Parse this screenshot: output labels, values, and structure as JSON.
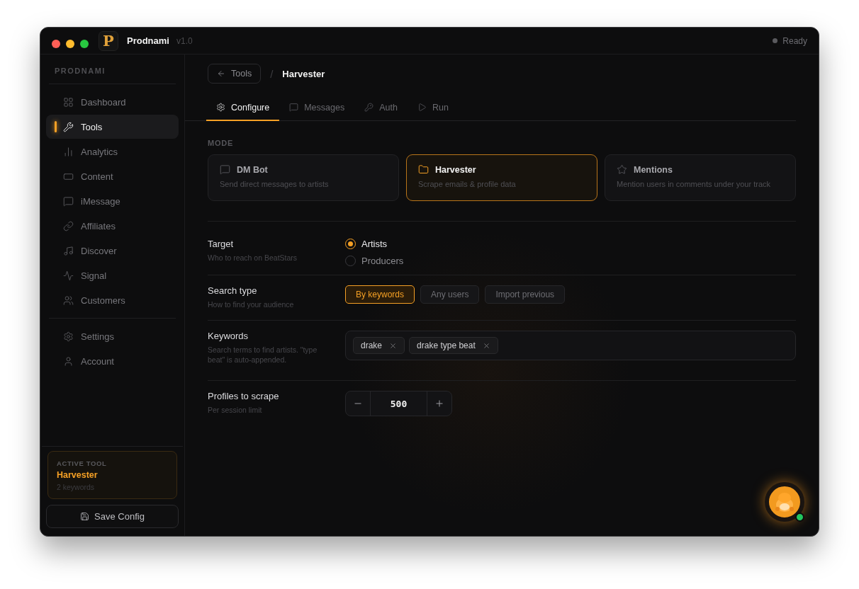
{
  "window": {
    "logo": "P",
    "title": "Prodnami",
    "version": "v1.0",
    "status": "Ready"
  },
  "sidebar": {
    "heading": "PRODNAMI",
    "items": [
      {
        "label": "Dashboard",
        "selected": false
      },
      {
        "label": "Tools",
        "selected": true
      },
      {
        "label": "Analytics",
        "selected": false
      },
      {
        "label": "Content",
        "selected": false
      },
      {
        "label": "iMessage",
        "selected": false
      },
      {
        "label": "Affiliates",
        "selected": false
      },
      {
        "label": "Discover",
        "selected": false
      },
      {
        "label": "Signal",
        "selected": false
      },
      {
        "label": "Customers",
        "selected": false
      }
    ],
    "secondary_items": [
      {
        "label": "Settings",
        "selected": false
      },
      {
        "label": "Account",
        "selected": false
      }
    ],
    "active_tool": {
      "label": "ACTIVE TOOL",
      "name": "Harvester",
      "detail": "2 keywords"
    },
    "save_button": "Save Config"
  },
  "breadcrumb": {
    "back": "Tools",
    "separator": "/",
    "current": "Harvester"
  },
  "tabs": [
    {
      "label": "Configure",
      "selected": true
    },
    {
      "label": "Messages",
      "selected": false
    },
    {
      "label": "Auth",
      "selected": false
    },
    {
      "label": "Run",
      "selected": false
    }
  ],
  "mode": {
    "heading": "MODE",
    "cards": [
      {
        "title": "DM Bot",
        "description": "Send direct messages to artists",
        "selected": false
      },
      {
        "title": "Harvester",
        "description": "Scrape emails & profile data",
        "selected": true
      },
      {
        "title": "Mentions",
        "description": "Mention users in comments under your track",
        "selected": false
      }
    ]
  },
  "settings": [
    {
      "kind": "radio",
      "label": "Target",
      "description": "Who to reach on BeatStars",
      "options": [
        {
          "label": "Artists",
          "selected": true
        },
        {
          "label": "Producers",
          "selected": false
        }
      ]
    },
    {
      "kind": "segmented",
      "label": "Search type",
      "description": "How to find your audience",
      "options": [
        {
          "label": "By keywords",
          "selected": true
        },
        {
          "label": "Any users",
          "selected": false
        },
        {
          "label": "Import previous",
          "selected": false
        }
      ]
    },
    {
      "kind": "tags",
      "label": "Keywords",
      "description": "Search terms to find artists. \"type beat\" is auto-appended.",
      "tags": [
        "drake",
        "drake type beat"
      ]
    },
    {
      "kind": "stepper",
      "label": "Profiles to scrape",
      "description": "Per session limit",
      "value": "500"
    }
  ],
  "assistant": {
    "online": true
  }
}
